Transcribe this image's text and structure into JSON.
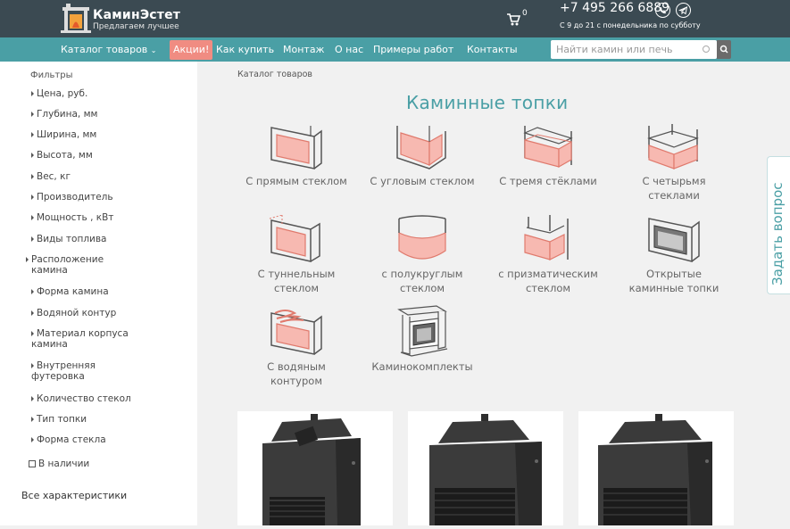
{
  "header": {
    "brand_name": "КаминЭстет",
    "brand_tagline": "Предлагаем лучшее",
    "cart_count": "0",
    "phone": "+7 495 266 6889",
    "hours": "С 9 до 21 с понедельника по субботу"
  },
  "nav": {
    "items": [
      "Каталог товаров",
      "Акции!",
      "Как купить",
      "Монтаж",
      "О нас",
      "Примеры работ",
      "Контакты"
    ]
  },
  "search": {
    "placeholder": "Найти камин или печь"
  },
  "sidebar": {
    "title": "Фильтры",
    "filters": [
      "Цена, руб.",
      "Глубина, мм",
      "Ширина, мм",
      "Высота, мм",
      "Вес, кг",
      "Производитель",
      "Мощность , кВт",
      "Виды топлива",
      "Расположение камина",
      "Форма камина",
      "Водяной контур",
      "Материал корпуса камина",
      "Внутренняя футеровка",
      "Количество стекол",
      "Тип топки",
      "Форма стекла"
    ],
    "in_stock_label": "В наличии",
    "all_characteristics": "Все характеристики"
  },
  "main": {
    "breadcrumb": "Каталог товаров",
    "title": "Каминные топки",
    "categories": [
      {
        "line1": "С прямым стеклом",
        "line2": ""
      },
      {
        "line1": "С угловым стеклом",
        "line2": ""
      },
      {
        "line1": "С тремя стёклами",
        "line2": ""
      },
      {
        "line1": "С четырьмя",
        "line2": "стеклами"
      },
      {
        "line1": "С туннельным",
        "line2": "стеклом"
      },
      {
        "line1": "с полукруглым",
        "line2": "стеклом"
      },
      {
        "line1": "с призматическим",
        "line2": "стеклом"
      },
      {
        "line1": "Открытые",
        "line2": "каминные топки"
      },
      {
        "line1": "С водяным",
        "line2": "контуром"
      },
      {
        "line1": "Каминокомплекты",
        "line2": ""
      }
    ]
  },
  "ask_tab": "Задать вопрос",
  "colors": {
    "header": "#3b4a52",
    "nav": "#4a9fa5",
    "accent": "#f08c82",
    "title": "#4a9fa5"
  }
}
